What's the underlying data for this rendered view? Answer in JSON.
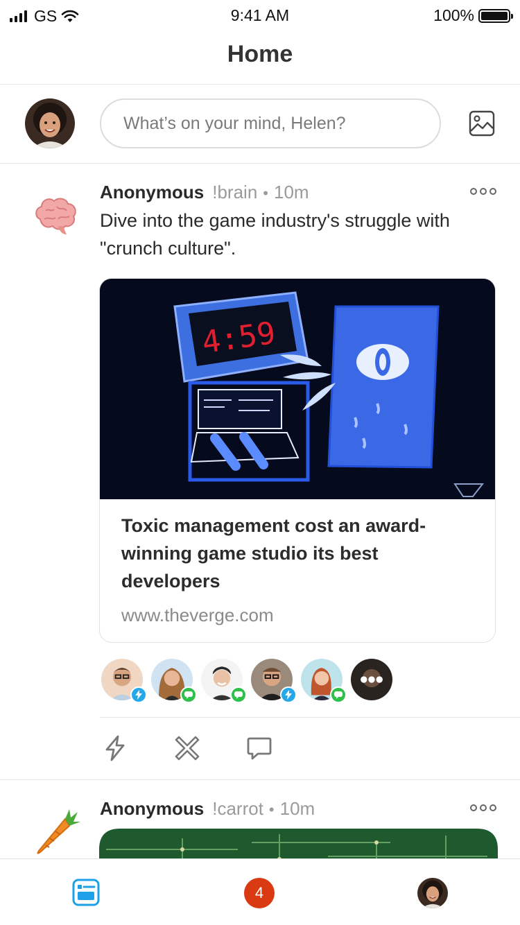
{
  "status_bar": {
    "carrier": "GS",
    "time": "9:41 AM",
    "battery": "100%"
  },
  "nav": {
    "title": "Home"
  },
  "composer": {
    "placeholder": "What’s on your mind, Helen?"
  },
  "posts": [
    {
      "author": "Anonymous",
      "handle": "!brain",
      "separator": "•",
      "ago": "10m",
      "emoji": "brain-icon",
      "text": "Dive into the game industry's struggle with \"crunch culture\".",
      "card": {
        "title": "Toxic management cost an award-winning game studio its best developers",
        "domain": "www.theverge.com",
        "clock_text": "4:59"
      },
      "reactions": [
        "zap",
        "chat",
        "chat",
        "zap",
        "chat",
        "more"
      ]
    },
    {
      "author": "Anonymous",
      "handle": "!carrot",
      "separator": "•",
      "ago": "10m",
      "emoji": "carrot-icon"
    }
  ],
  "tabbar": {
    "notifications_count": "4"
  },
  "colors": {
    "accent": "#25a8ea",
    "chat_green": "#2fbf4b",
    "notif_red": "#d93a12"
  }
}
